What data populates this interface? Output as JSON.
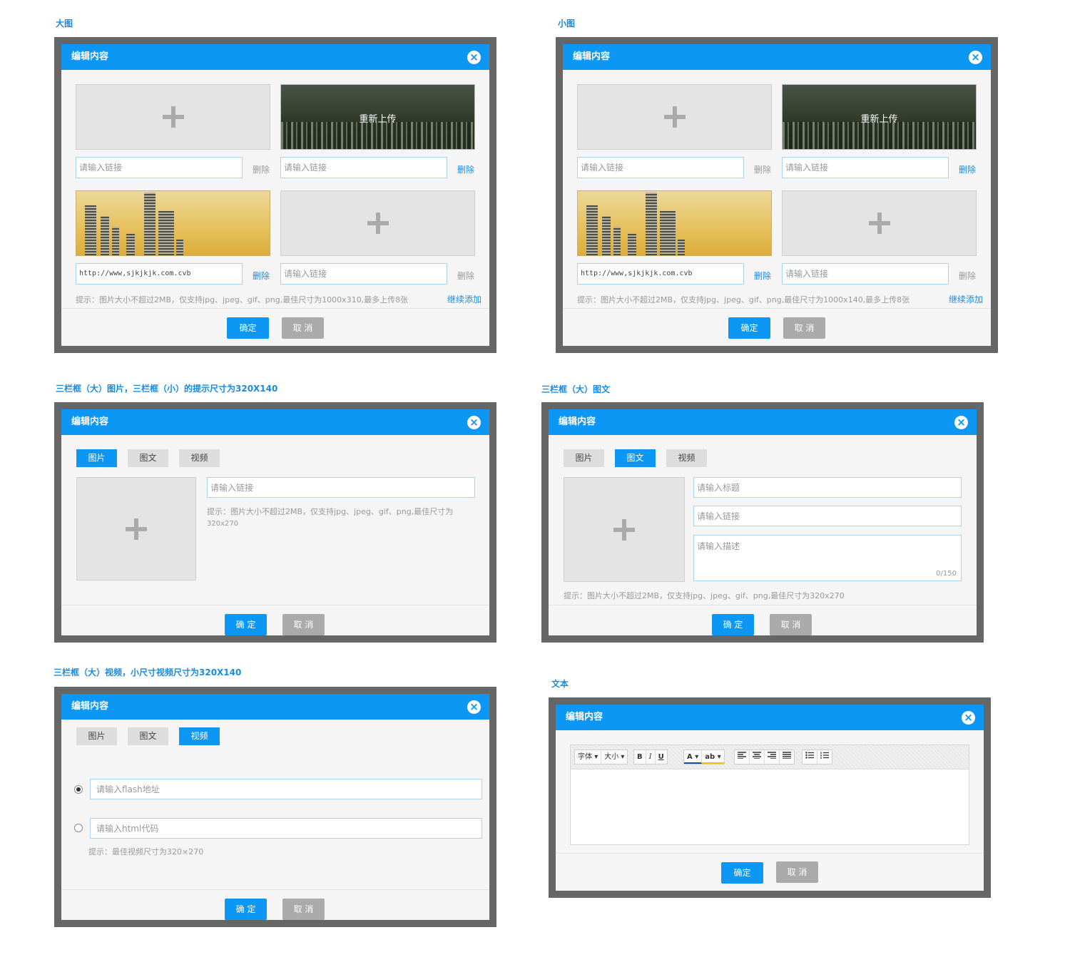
{
  "sections": {
    "big": "大图",
    "small": "小图",
    "three_img": "三栏框（大）图片，三栏框（小）的提示尺寸为320X140",
    "three_text": "三栏框（大）图文",
    "three_video": "三栏框（大）视频，小尺寸视频尺寸为320X140",
    "text": "文本"
  },
  "common": {
    "dialog_title": "编辑内容",
    "close": "×",
    "link_placeholder": "请输入链接",
    "delete": "删除",
    "reupload": "重新上传",
    "url_value": "http://www,sjkjkjk.com.cvb",
    "continue_add": "继续添加",
    "ok": "确定",
    "cancel": "取 消",
    "ok_spaced": "确 定",
    "tab_image": "图片",
    "tab_imgtext": "图文",
    "tab_video": "视频"
  },
  "big": {
    "hint": "提示：图片大小不超过2MB，仅支持jpg、jpeg、gif、png,最佳尺寸为1000x310,最多上传8张"
  },
  "small": {
    "hint": "提示：图片大小不超过2MB，仅支持jpg、jpeg、gif、png,最佳尺寸为1000x140,最多上传8张"
  },
  "three_img": {
    "hint_line1": "提示：图片大小不超过2MB，仅支持jpg、jpeg、gif、png,最佳尺寸为",
    "hint_line2": "320x270"
  },
  "three_text": {
    "title_placeholder": "请输入标题",
    "desc_placeholder": "请输入描述",
    "counter": "0/150",
    "hint": "提示：图片大小不超过2MB，仅支持jpg、jpeg、gif、png,最佳尺寸为320x270"
  },
  "three_video": {
    "flash_placeholder": "请输入flash地址",
    "html_placeholder": "请输入html代码",
    "hint": "提示：最佳视频尺寸为320×270",
    "selected_option": "flash"
  },
  "text_editor": {
    "font": "字体",
    "size": "大小",
    "bold": "B",
    "italic": "I",
    "underline": "U",
    "font_color": "A",
    "highlight": "ab",
    "dropdown": "▾",
    "align_left_icon": "align-left-icon",
    "align_center_icon": "align-center-icon",
    "align_right_icon": "align-right-icon",
    "justify_icon": "justify-icon",
    "bullet_list_icon": "bullet-list-icon",
    "number_list_icon": "number-list-icon"
  },
  "colors": {
    "accent": "#0c97f5",
    "frame": "#666666",
    "cancel": "#aaaaaa"
  }
}
